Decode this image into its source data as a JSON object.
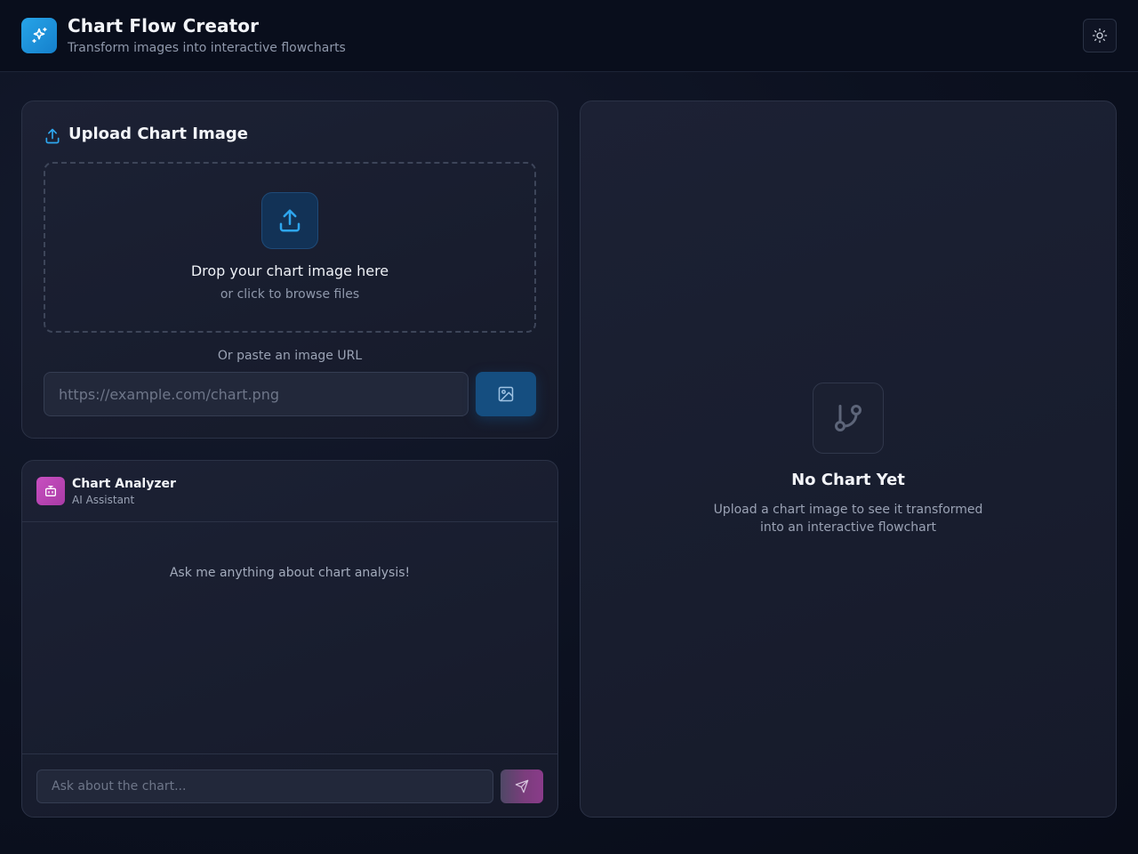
{
  "header": {
    "title": "Chart Flow Creator",
    "subtitle": "Transform images into interactive flowcharts",
    "logo_icon": "sparkles-icon",
    "theme_toggle_icon": "sun-icon"
  },
  "upload": {
    "heading": "Upload Chart Image",
    "heading_icon": "upload-icon",
    "dropzone": {
      "title": "Drop your chart image here",
      "subtitle": "or click to browse files",
      "icon": "upload-icon"
    },
    "url_label": "Or paste an image URL",
    "url_placeholder": "https://example.com/chart.png",
    "url_value": "",
    "url_submit_icon": "image-icon"
  },
  "chat": {
    "title": "Chart Analyzer",
    "subtitle": "AI Assistant",
    "avatar_icon": "bot-icon",
    "empty_message": "Ask me anything about chart analysis!",
    "input_placeholder": "Ask about the chart...",
    "input_value": "",
    "send_icon": "send-icon"
  },
  "preview": {
    "empty_icon": "git-branch-icon",
    "empty_title": "No Chart Yet",
    "empty_description": "Upload a chart image to see it transformed into an interactive flowchart"
  },
  "colors": {
    "accent_blue": "#27a4e8",
    "accent_magenta": "#c84fc0",
    "background": "#0c1120",
    "card": "#1c2134"
  }
}
